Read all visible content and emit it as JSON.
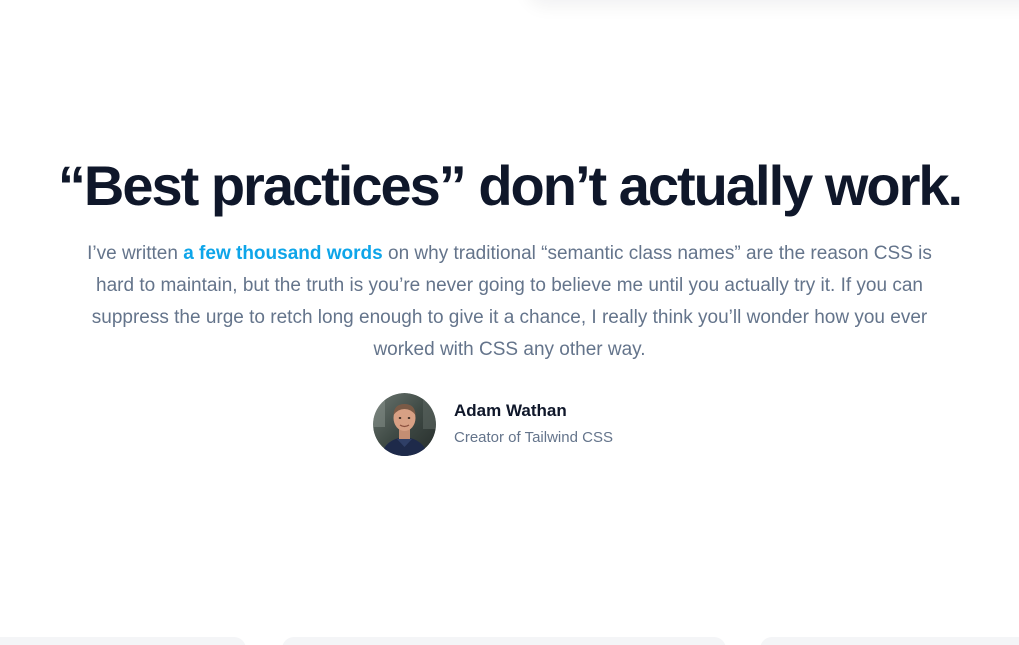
{
  "testimonial": {
    "headline": "“Best practices” don’t actually work.",
    "quote_before": "I’ve written ",
    "quote_link": "a few thousand words",
    "quote_after": " on why traditional “semantic class names” are the reason CSS is hard to maintain, but the truth is you’re never going to believe me until you actually try it. If you can suppress the urge to retch long enough to give it a chance, I really think you’ll wonder how you ever worked with CSS any other way.",
    "author": {
      "name": "Adam Wathan",
      "role": "Creator of Tailwind CSS",
      "avatar_icon": "person-photo-icon"
    }
  },
  "colors": {
    "headline": "#0f172a",
    "body_text": "#64748b",
    "link": "#0ea5e9"
  }
}
